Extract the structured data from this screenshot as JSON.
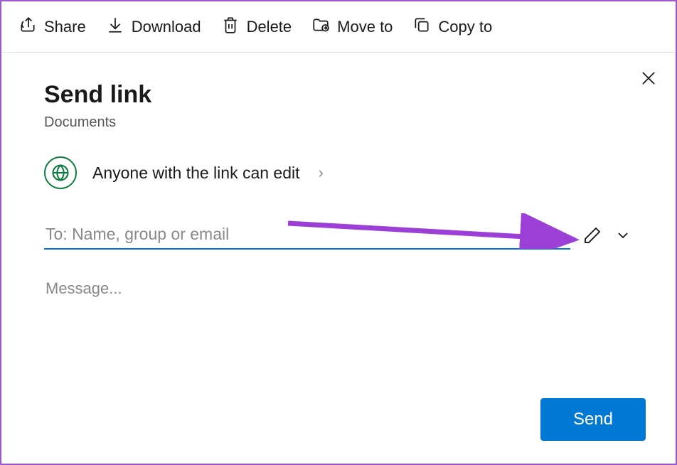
{
  "toolbar": {
    "share": "Share",
    "download": "Download",
    "delete": "Delete",
    "move_to": "Move to",
    "copy_to": "Copy to"
  },
  "dialog": {
    "title": "Send link",
    "subtitle": "Documents",
    "permission_text": "Anyone with the link can edit",
    "to_placeholder": "To: Name, group or email",
    "message_placeholder": "Message...",
    "send_label": "Send"
  }
}
